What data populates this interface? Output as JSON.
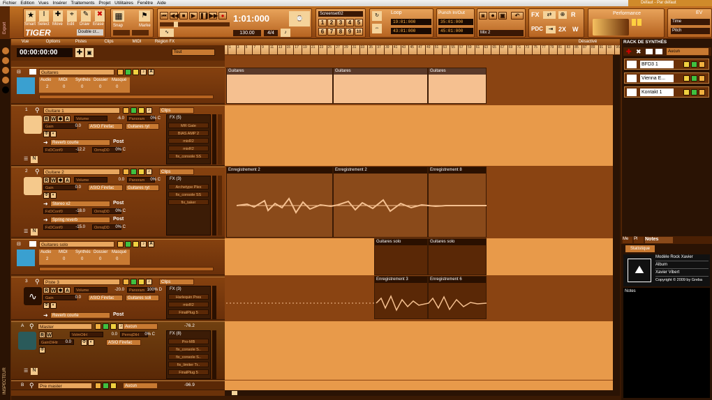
{
  "menu": [
    "Fichier",
    "Edition",
    "Vues",
    "Insérer",
    "Traitements",
    "Projet",
    "Utilitaires",
    "Fenêtre",
    "Aide"
  ],
  "title_tag": "Défaut - Par défaut",
  "tools": {
    "smart": "Smart",
    "select": "Select",
    "move": "Move",
    "edit": "Edit",
    "draw": "Draw",
    "erase": "Erase",
    "tiger": "TIGER",
    "double": "Double cr..."
  },
  "snap": {
    "snap": "Snap",
    "marks": "Marke"
  },
  "transport": {
    "time": "1:01:000",
    "tempo": "130.00",
    "sig": "4/4",
    "zoom_label": "Screenset02"
  },
  "screensets": [
    "1",
    "2",
    "3",
    "4",
    "5",
    "6",
    "7",
    "8",
    "9",
    "10"
  ],
  "loop": {
    "label": "Loop",
    "start": "19:01:000",
    "end": "43:01:000"
  },
  "punch": {
    "label": "Punch In/Out",
    "start": "35:01:000",
    "end": "45:01:000"
  },
  "mix": {
    "label": "Mix 2",
    "fx": "FX",
    "pdc": "PDC",
    "x2": "2X",
    "w": "W",
    "r": "R"
  },
  "performance": {
    "label": "Performance"
  },
  "ev": {
    "label": "EV",
    "time": "Time",
    "pitch": "Pitch"
  },
  "subbar": [
    "Vue",
    "Options",
    "Pistes",
    "Clips",
    "MIDI",
    "Région FX"
  ],
  "counter": "00:00:00:00",
  "filter": "Tout",
  "desactive": "Désactivé",
  "tracks": {
    "g1": {
      "name": "Guitares",
      "labels": [
        "Audio",
        "MIDI",
        "Synthés",
        "Dossier",
        "Masqué"
      ],
      "values": [
        "2",
        "0",
        "0",
        "0",
        "0"
      ]
    },
    "t1": {
      "num": "1",
      "name": "Guitare 1",
      "clips": "Clips",
      "volume_lbl": "Volume",
      "volume": "-6.0",
      "pan_lbl": "Panoram",
      "pan": "0% C",
      "gain_lbl": "Gain",
      "gain": "0.0",
      "input": "ASIO Firefac",
      "output": "Guitares ryt",
      "send": "Reverb courte",
      "send_lbl": "FxDConf0",
      "send_val": "-12.2",
      "send2_lbl": "OrmqDD",
      "send2_val": "0% C",
      "post": "Post",
      "fx_title": "FX (5)",
      "fx": [
        "MR Gate",
        "BIAS AMP 2",
        "mixR2",
        "mixR2",
        "fix_console SS"
      ]
    },
    "t2": {
      "num": "2",
      "name": "Guitare 2",
      "clips": "Clips",
      "volume_lbl": "Volume",
      "volume": "0.0",
      "pan_lbl": "Panoram",
      "pan": "0% C",
      "gain_lbl": "Gain",
      "gain": "0.0",
      "input": "ASIO Firefac",
      "output": "Guitares ryt",
      "send": "Stereo x2",
      "send_lbl": "FxDConf0",
      "send_val": "-18.0",
      "send2_lbl": "OrmqDD",
      "send2_val": "0% C",
      "send3": "Spring reverb",
      "send3_lbl": "FxDConf0",
      "send3_val": "-15.0",
      "send4_lbl": "OrmqDD",
      "send4_val": "0% C",
      "post": "Post",
      "fx_title": "FX (3)",
      "fx": [
        "Archetype Plex",
        "fix_console SS",
        "fix_taker"
      ]
    },
    "g2": {
      "name": "Guitares solo",
      "labels": [
        "Audio",
        "MIDI",
        "Synthés",
        "Dossier",
        "Masqué"
      ],
      "values": [
        "2",
        "0",
        "0",
        "0",
        "0"
      ]
    },
    "t3": {
      "num": "3",
      "name": "Piste 3",
      "clips": "Clips",
      "volume_lbl": "Volume",
      "volume": "-20.0",
      "pan_lbl": "Panoram",
      "pan": "100% D",
      "gain_lbl": "Gain",
      "gain": "0.0",
      "input": "ASIO Firefac",
      "output": "Guitares soli",
      "send": "Reverb courte",
      "post": "Post",
      "fx_title": "FX (3)",
      "fx": [
        "Harlequin Pres",
        "mixR2",
        "FinalPlug 5"
      ]
    },
    "master": {
      "num": "A",
      "name": "Master",
      "output": "Aucun",
      "value": "-76.2",
      "volume_lbl": "VolmOtH",
      "volume": "0.0",
      "pan_lbl": "PernqDtH",
      "pan": "0% C",
      "gain_lbl": "GainDiHtr",
      "gain": "0.0",
      "out": "ASIO Firefac",
      "fx_title": "FX (8)",
      "fx": [
        "Pro-MB",
        "fix_console S..",
        "fix_console S..",
        "fix_limiter Tr..",
        "FinalPlug 5"
      ]
    },
    "premaster": {
      "num": "B",
      "name": "Pre master",
      "output": "Aucun",
      "value": "-96.9"
    }
  },
  "clips": {
    "folder1": [
      "Guitares",
      "Guitares",
      "Guitares"
    ],
    "track2": [
      "Enregistrement 2",
      "Enregistrement 2",
      "Enregistrement 8"
    ],
    "folder2": [
      "Guitares solo",
      "Guitares solo"
    ],
    "track3": [
      "Enregistrement 3",
      "Enregistrement 6"
    ]
  },
  "ruler_marks": [
    "1",
    "3",
    "5",
    "7",
    "9",
    "11",
    "13",
    "15",
    "17",
    "19",
    "21",
    "23",
    "25",
    "27",
    "29",
    "31",
    "33",
    "35",
    "37",
    "39",
    "41",
    "43",
    "45",
    "47",
    "49",
    "51",
    "53",
    "55",
    "57",
    "59",
    "61",
    "63",
    "65",
    "67",
    "69",
    "71",
    "73",
    "75",
    "77",
    "79",
    "81",
    "83",
    "85",
    "87",
    "89",
    "91",
    "93",
    "95"
  ],
  "rack": {
    "title": "RACK DE SYNTHÉS",
    "filter": "Aucun",
    "items": [
      "BFD3 1",
      "Vienna E...",
      "Kontakt 1"
    ]
  },
  "notes": {
    "tabs": [
      "Me",
      "Pl",
      "Notes"
    ],
    "stats": "Statistique",
    "fields": [
      "Modèle Rock Xavier",
      "Album",
      "Xavier Vibert",
      "Copyright © 2009 by Greba"
    ],
    "notes_label": "Notes"
  },
  "inspector_label": "INSPECTEUR",
  "export_label": "Export"
}
